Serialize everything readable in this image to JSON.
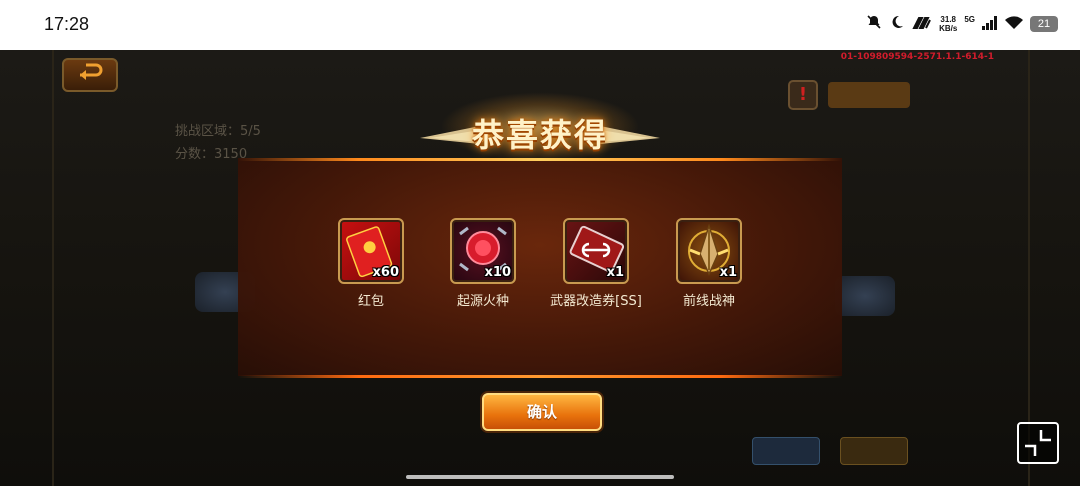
{
  "status_bar": {
    "time": "17:28",
    "net_speed_value": "31.8",
    "net_speed_unit": "KB/s",
    "network": "5G",
    "battery": "21"
  },
  "game": {
    "build_id": "01-109809594-2571.1.1-614-1",
    "challenge_area": "挑战区域：5/5",
    "score": "分数：3150"
  },
  "dialog": {
    "title": "恭喜获得",
    "rewards": [
      {
        "name": "红包",
        "qty": "x60",
        "icon": "red-envelope-icon"
      },
      {
        "name": "起源火种",
        "qty": "x10",
        "icon": "origin-fire-icon"
      },
      {
        "name": "武器改造券[SS]",
        "qty": "x1",
        "icon": "weapon-ticket-icon"
      },
      {
        "name": "前线战神",
        "qty": "x1",
        "icon": "war-god-icon"
      }
    ],
    "confirm_label": "确认"
  },
  "colors": {
    "accent": "#ff8a1c",
    "confirm": "#e8720c",
    "build_id": "#d21c2c"
  }
}
